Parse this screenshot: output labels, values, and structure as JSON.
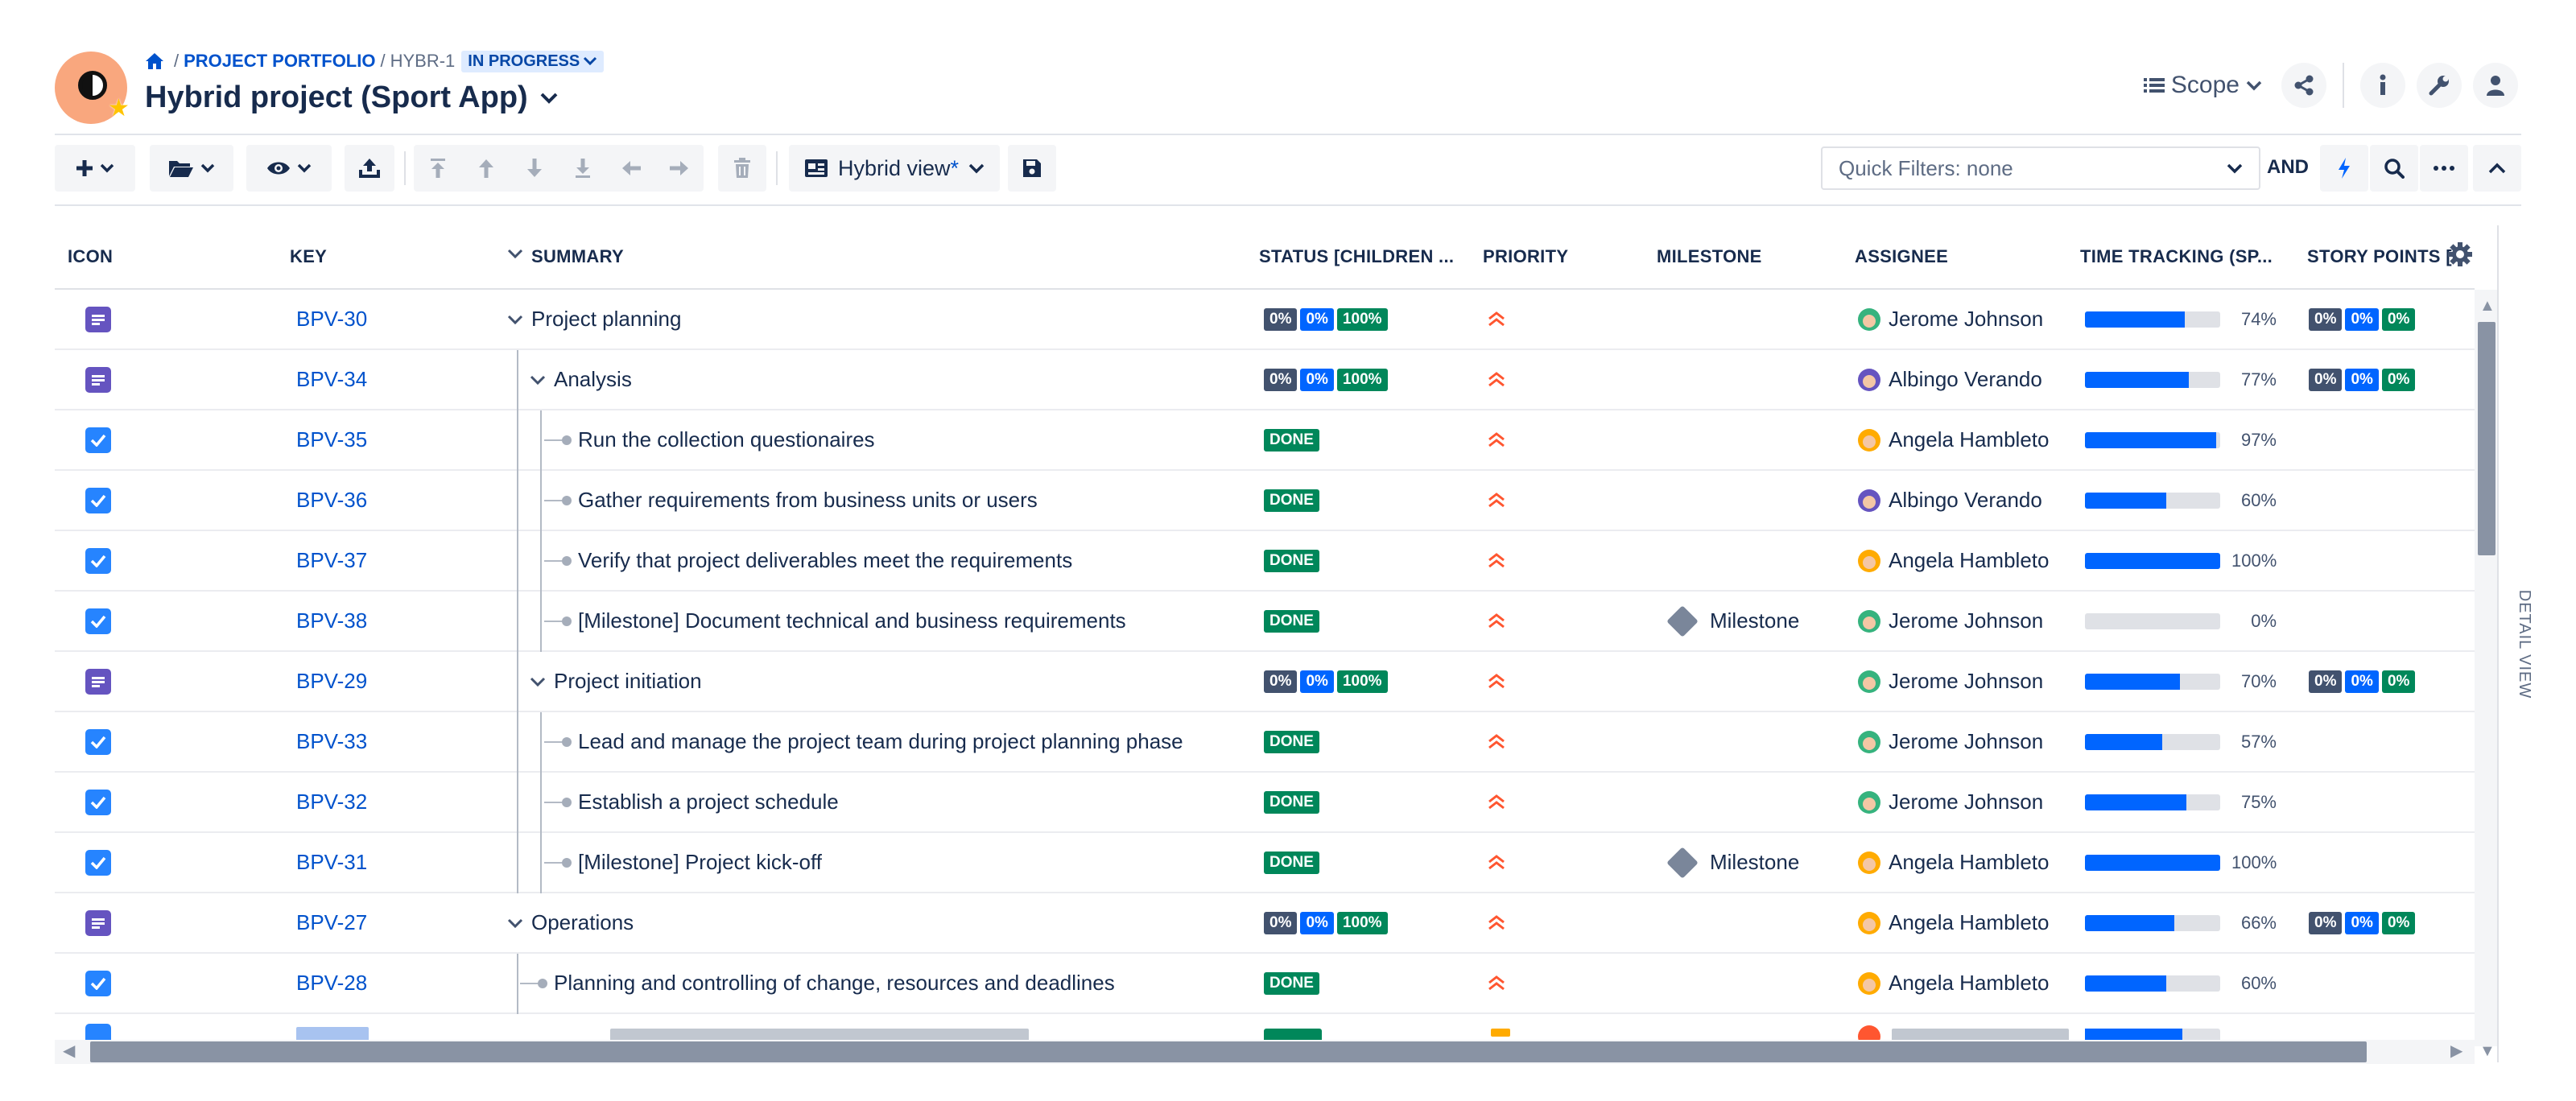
{
  "breadcrumb": {
    "portfolio": "PROJECT PORTFOLIO",
    "key": "HYBR-1",
    "status": "IN PROGRESS"
  },
  "title": "Hybrid project (Sport App)",
  "header_actions": {
    "scope_label": "Scope"
  },
  "toolbar": {
    "view_label": "Hybrid view",
    "view_modified_marker": "*",
    "quick_filters": "Quick Filters: none",
    "and_label": "AND"
  },
  "columns": {
    "icon": "ICON",
    "key": "KEY",
    "summary": "SUMMARY",
    "status": "STATUS [CHILDREN ...",
    "priority": "PRIORITY",
    "milestone": "MILESTONE",
    "assignee": "ASSIGNEE",
    "time_tracking": "TIME TRACKING (SP...",
    "story_points": "STORY POINTS ["
  },
  "rows": [
    {
      "type": "story",
      "key": "BPV-30",
      "summary": "Project planning",
      "status": [
        "0%",
        "0%",
        "100%"
      ],
      "milestone": "",
      "assignee": "Jerome Johnson",
      "progress": 74,
      "progress_label": "74%",
      "story_points": [
        "0%",
        "0%",
        "0%"
      ]
    },
    {
      "type": "story",
      "key": "BPV-34",
      "summary": "Analysis",
      "status": [
        "0%",
        "0%",
        "100%"
      ],
      "milestone": "",
      "assignee": "Albingo Verando",
      "progress": 77,
      "progress_label": "77%",
      "story_points": [
        "0%",
        "0%",
        "0%"
      ]
    },
    {
      "type": "task",
      "key": "BPV-35",
      "summary": "Run the collection questionaires",
      "status": [
        "DONE"
      ],
      "milestone": "",
      "assignee": "Angela Hambleto",
      "progress": 97,
      "progress_label": "97%",
      "story_points": []
    },
    {
      "type": "task",
      "key": "BPV-36",
      "summary": "Gather requirements from business units or users",
      "status": [
        "DONE"
      ],
      "milestone": "",
      "assignee": "Albingo Verando",
      "progress": 60,
      "progress_label": "60%",
      "story_points": []
    },
    {
      "type": "task",
      "key": "BPV-37",
      "summary": "Verify that project deliverables meet the requirements",
      "status": [
        "DONE"
      ],
      "milestone": "",
      "assignee": "Angela Hambleto",
      "progress": 100,
      "progress_label": "100%",
      "story_points": []
    },
    {
      "type": "task",
      "key": "BPV-38",
      "summary": "[Milestone] Document technical and business requirements",
      "status": [
        "DONE"
      ],
      "milestone": "Milestone",
      "assignee": "Jerome Johnson",
      "progress": 0,
      "progress_label": "0%",
      "story_points": []
    },
    {
      "type": "story",
      "key": "BPV-29",
      "summary": "Project initiation",
      "status": [
        "0%",
        "0%",
        "100%"
      ],
      "milestone": "",
      "assignee": "Jerome Johnson",
      "progress": 70,
      "progress_label": "70%",
      "story_points": [
        "0%",
        "0%",
        "0%"
      ]
    },
    {
      "type": "task",
      "key": "BPV-33",
      "summary": "Lead and manage the project team during project planning phase",
      "status": [
        "DONE"
      ],
      "milestone": "",
      "assignee": "Jerome Johnson",
      "progress": 57,
      "progress_label": "57%",
      "story_points": []
    },
    {
      "type": "task",
      "key": "BPV-32",
      "summary": "Establish a project schedule",
      "status": [
        "DONE"
      ],
      "milestone": "",
      "assignee": "Jerome Johnson",
      "progress": 75,
      "progress_label": "75%",
      "story_points": []
    },
    {
      "type": "task",
      "key": "BPV-31",
      "summary": "[Milestone] Project kick-off",
      "status": [
        "DONE"
      ],
      "milestone": "Milestone",
      "assignee": "Angela Hambleto",
      "progress": 100,
      "progress_label": "100%",
      "story_points": []
    },
    {
      "type": "story",
      "key": "BPV-27",
      "summary": "Operations",
      "status": [
        "0%",
        "0%",
        "100%"
      ],
      "milestone": "",
      "assignee": "Angela Hambleto",
      "progress": 66,
      "progress_label": "66%",
      "story_points": [
        "0%",
        "0%",
        "0%"
      ]
    },
    {
      "type": "task",
      "key": "BPV-28",
      "summary": "Planning and controlling of change, resources and deadlines",
      "status": [
        "DONE"
      ],
      "milestone": "",
      "assignee": "Angela Hambleto",
      "progress": 60,
      "progress_label": "60%",
      "story_points": []
    }
  ],
  "assignee_colors": {
    "Jerome Johnson": "#36b37e",
    "Albingo Verando": "#6554c0",
    "Angela Hambleto": "#ffab00"
  },
  "side_panel_label": "DETAIL VIEW",
  "colors": {
    "link": "#0052cc",
    "priority_high": "#ff5630",
    "status_done": "#00875a",
    "progress": "#0065ff"
  }
}
